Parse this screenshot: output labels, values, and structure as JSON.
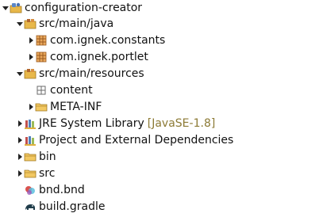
{
  "tree": {
    "root": {
      "label": "configuration-creator",
      "icon": "gradle-project-icon",
      "expanded": true
    },
    "src_main_java": {
      "label": "src/main/java",
      "icon": "source-folder-icon",
      "expanded": true
    },
    "pkg_constants": {
      "label": "com.ignek.constants",
      "icon": "package-icon",
      "expanded": false
    },
    "pkg_portlet": {
      "label": "com.ignek.portlet",
      "icon": "package-icon",
      "expanded": false
    },
    "src_main_resources": {
      "label": "src/main/resources",
      "icon": "source-folder-icon",
      "expanded": true
    },
    "content": {
      "label": "content",
      "icon": "empty-package-icon",
      "expanded": false
    },
    "meta_inf": {
      "label": "META-INF",
      "icon": "folder-icon",
      "expanded": false
    },
    "jre": {
      "label": "JRE System Library",
      "decoration": "[JavaSE-1.8]",
      "icon": "library-icon",
      "expanded": false
    },
    "deps": {
      "label": "Project and External Dependencies",
      "icon": "library-icon",
      "expanded": false
    },
    "bin": {
      "label": "bin",
      "icon": "folder-icon",
      "expanded": false
    },
    "src": {
      "label": "src",
      "icon": "folder-icon",
      "expanded": false
    },
    "bnd": {
      "label": "bnd.bnd",
      "icon": "bnd-file-icon"
    },
    "gradle": {
      "label": "build.gradle",
      "icon": "gradle-file-icon"
    }
  },
  "colors": {
    "folder": "#e8b84a",
    "package": "#b2662d",
    "text": "#111111",
    "decoration": "#8c7a35"
  }
}
